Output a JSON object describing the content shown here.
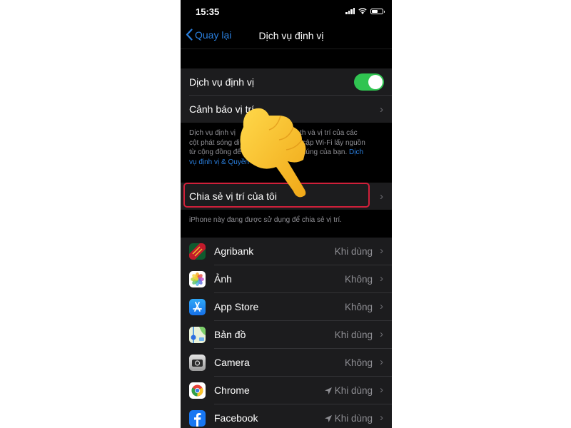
{
  "status_bar": {
    "time": "15:35"
  },
  "nav": {
    "back_label": "Quay lại",
    "title": "Dịch vụ định vị"
  },
  "settings": {
    "location_services_label": "Dịch vụ định vị",
    "location_services_on": true,
    "location_alerts_label": "Cảnh báo vị trí",
    "description_text": "Dịch vụ định vị  ... bluetooth và vị trí của các cột phát sóng di ... y cập Wi-Fi lấy nguồn từ cộng đồng để ... đúng của bạn.",
    "description_line1": "Dịch vụ định vị",
    "description_line1b": "luetooth và vị trí của các",
    "description_line2": "cột phát sóng di",
    "description_line2b": "y cập Wi-Fi lấy nguồn",
    "description_line3": "từ cộng đồng để",
    "description_line3b": "đúng của bạn.",
    "description_link_a": "Dịch",
    "description_link_b": "vụ định vị & Quyền",
    "share_location_label": "Chia sẻ vị trí của tôi",
    "share_footnote": "iPhone này đang được sử dụng để chia sẻ vị trí."
  },
  "apps": [
    {
      "name": "Agribank",
      "value": "Khi dùng",
      "recent": false,
      "icon": "agribank-icon"
    },
    {
      "name": "Ảnh",
      "value": "Không",
      "recent": false,
      "icon": "photos-icon"
    },
    {
      "name": "App Store",
      "value": "Không",
      "recent": false,
      "icon": "app-store-icon"
    },
    {
      "name": "Bản đồ",
      "value": "Khi dùng",
      "recent": false,
      "icon": "maps-icon"
    },
    {
      "name": "Camera",
      "value": "Không",
      "recent": false,
      "icon": "camera-icon"
    },
    {
      "name": "Chrome",
      "value": "Khi dùng",
      "recent": true,
      "icon": "chrome-icon"
    },
    {
      "name": "Facebook",
      "value": "Khi dùng",
      "recent": true,
      "icon": "facebook-icon"
    }
  ],
  "colors": {
    "accent": "#2a7fde",
    "toggle_on": "#30c451",
    "highlight": "#d0203a"
  }
}
